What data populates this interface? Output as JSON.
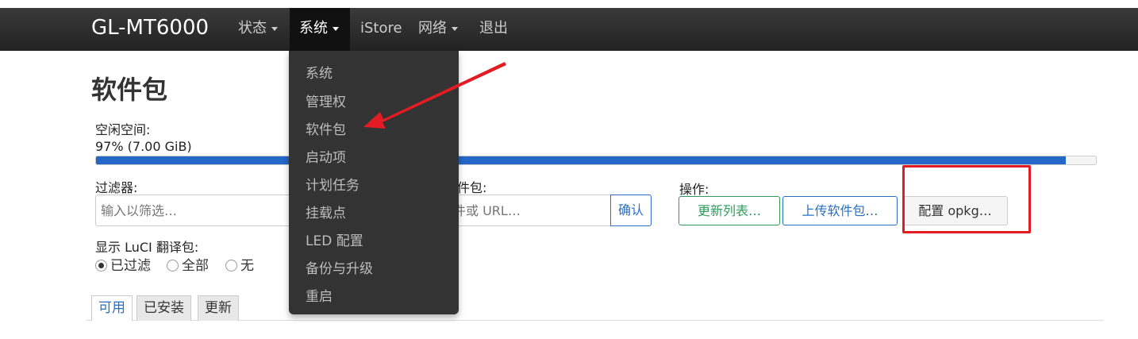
{
  "navbar": {
    "brand": "GL-MT6000",
    "items": [
      {
        "label": "状态",
        "dropdown": true
      },
      {
        "label": "系统",
        "dropdown": true,
        "active": true
      },
      {
        "label": "iStore",
        "dropdown": false
      },
      {
        "label": "网络",
        "dropdown": true
      },
      {
        "label": "退出",
        "dropdown": false
      }
    ]
  },
  "dropdown": {
    "items": [
      "系统",
      "管理权",
      "软件包",
      "启动项",
      "计划任务",
      "挂载点",
      "LED 配置",
      "备份与升级",
      "重启"
    ]
  },
  "page": {
    "title": "软件包",
    "free_space_label": "空闲空间:",
    "free_space_value": "97% (7.00 GiB)",
    "free_space_fraction": 0.97,
    "filter_label": "过滤器:",
    "filter_placeholder": "输入以筛选…",
    "download_label": "软件包:",
    "download_placeholder": "文件或 URL…",
    "confirm_button": "确认",
    "actions_label": "操作:",
    "update_lists_button": "更新列表…",
    "upload_button": "上传软件包…",
    "configure_button": "配置 opkg…",
    "translation_label": "显示 LuCI 翻译包:",
    "radio_options": [
      {
        "label": "已过滤",
        "checked": true
      },
      {
        "label": "全部",
        "checked": false
      },
      {
        "label": "无",
        "checked": false
      }
    ],
    "tabs": [
      {
        "label": "可用",
        "active": true
      },
      {
        "label": "已安装",
        "active": false
      },
      {
        "label": "更新",
        "active": false
      }
    ]
  },
  "colors": {
    "accent": "#2567c6",
    "annotation": "#e31b23",
    "success": "#2f9c5b"
  }
}
